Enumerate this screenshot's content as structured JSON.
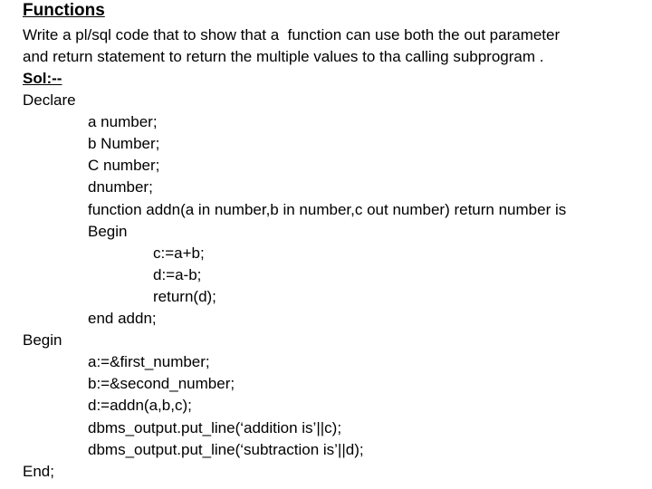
{
  "title": "Functions",
  "question": [
    "Write a pl/sql code that to show that a  function can use both the out parameter",
    "and return statement to return the multiple values to tha calling subprogram ."
  ],
  "solution_label": "Sol:--",
  "code": [
    {
      "indent": 0,
      "text": "Declare"
    },
    {
      "indent": 1,
      "text": "a number;"
    },
    {
      "indent": 1,
      "text": "b Number;"
    },
    {
      "indent": 1,
      "text": "C number;"
    },
    {
      "indent": 1,
      "text": "dnumber;"
    },
    {
      "indent": 1,
      "text": "function addn(a in number,b in number,c out number) return number is"
    },
    {
      "indent": 1,
      "text": "Begin"
    },
    {
      "indent": 2,
      "text": "c:=a+b;"
    },
    {
      "indent": 2,
      "text": "d:=a-b;"
    },
    {
      "indent": 2,
      "text": "return(d);"
    },
    {
      "indent": 1,
      "text": "end addn;"
    },
    {
      "indent": 0,
      "text": "Begin"
    },
    {
      "indent": 1,
      "text": "a:=&first_number;"
    },
    {
      "indent": 1,
      "text": "b:=&second_number;"
    },
    {
      "indent": 1,
      "text": "d:=addn(a,b,c);"
    },
    {
      "indent": 1,
      "text": "dbms_output.put_line(‘addition is’||c);"
    },
    {
      "indent": 1,
      "text": "dbms_output.put_line(‘subtraction is’||d);"
    },
    {
      "indent": 0,
      "text": "End;"
    }
  ]
}
